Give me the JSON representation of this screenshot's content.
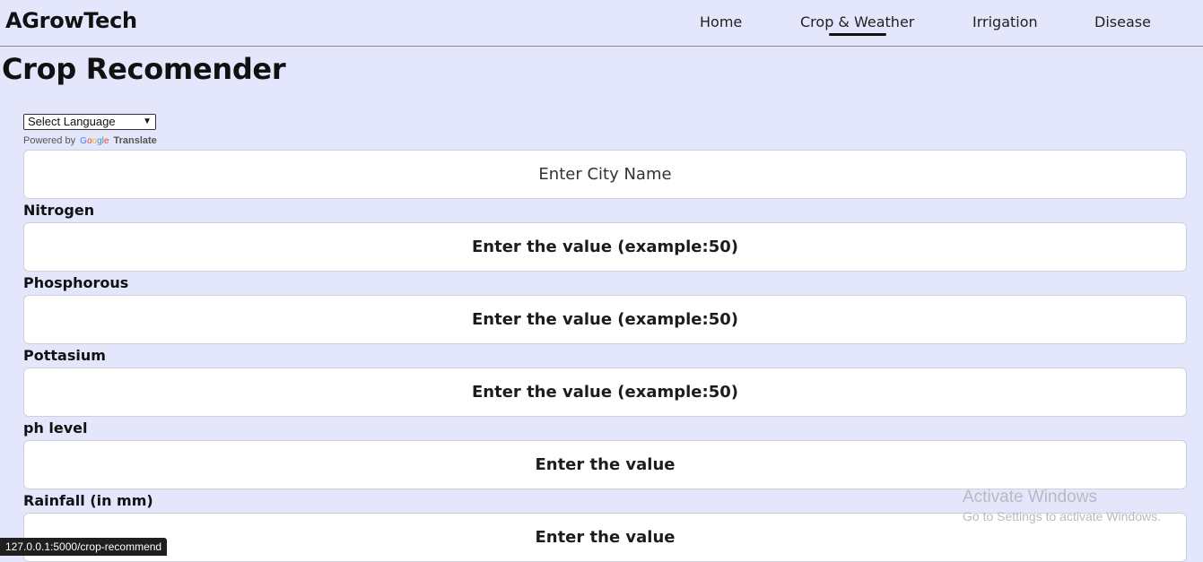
{
  "navbar": {
    "brand": "AGrowTech",
    "links": [
      {
        "label": "Home"
      },
      {
        "label": "Crop & Weather",
        "active": true
      },
      {
        "label": "Irrigation"
      },
      {
        "label": "Disease"
      }
    ]
  },
  "page": {
    "title": "Crop Recomender"
  },
  "translate": {
    "select_value": "Select Language",
    "powered_by": "Powered by",
    "google": "Google",
    "translate": "Translate"
  },
  "form": {
    "city": {
      "placeholder": "Enter City Name"
    },
    "fields": [
      {
        "label": "Nitrogen",
        "placeholder": "Enter the value (example:50)"
      },
      {
        "label": "Phosphorous",
        "placeholder": "Enter the value (example:50)"
      },
      {
        "label": "Pottasium",
        "placeholder": "Enter the value (example:50)"
      },
      {
        "label": "ph level",
        "placeholder": "Enter the value"
      },
      {
        "label": "Rainfall (in mm)",
        "placeholder": "Enter the value"
      }
    ]
  },
  "watermark": {
    "title": "Activate Windows",
    "subtitle": "Go to Settings to activate Windows."
  },
  "statusbar": {
    "url": "127.0.0.1:5000/crop-recommend"
  },
  "colors": {
    "background": "#e4e6fb",
    "accent": "#111111"
  }
}
